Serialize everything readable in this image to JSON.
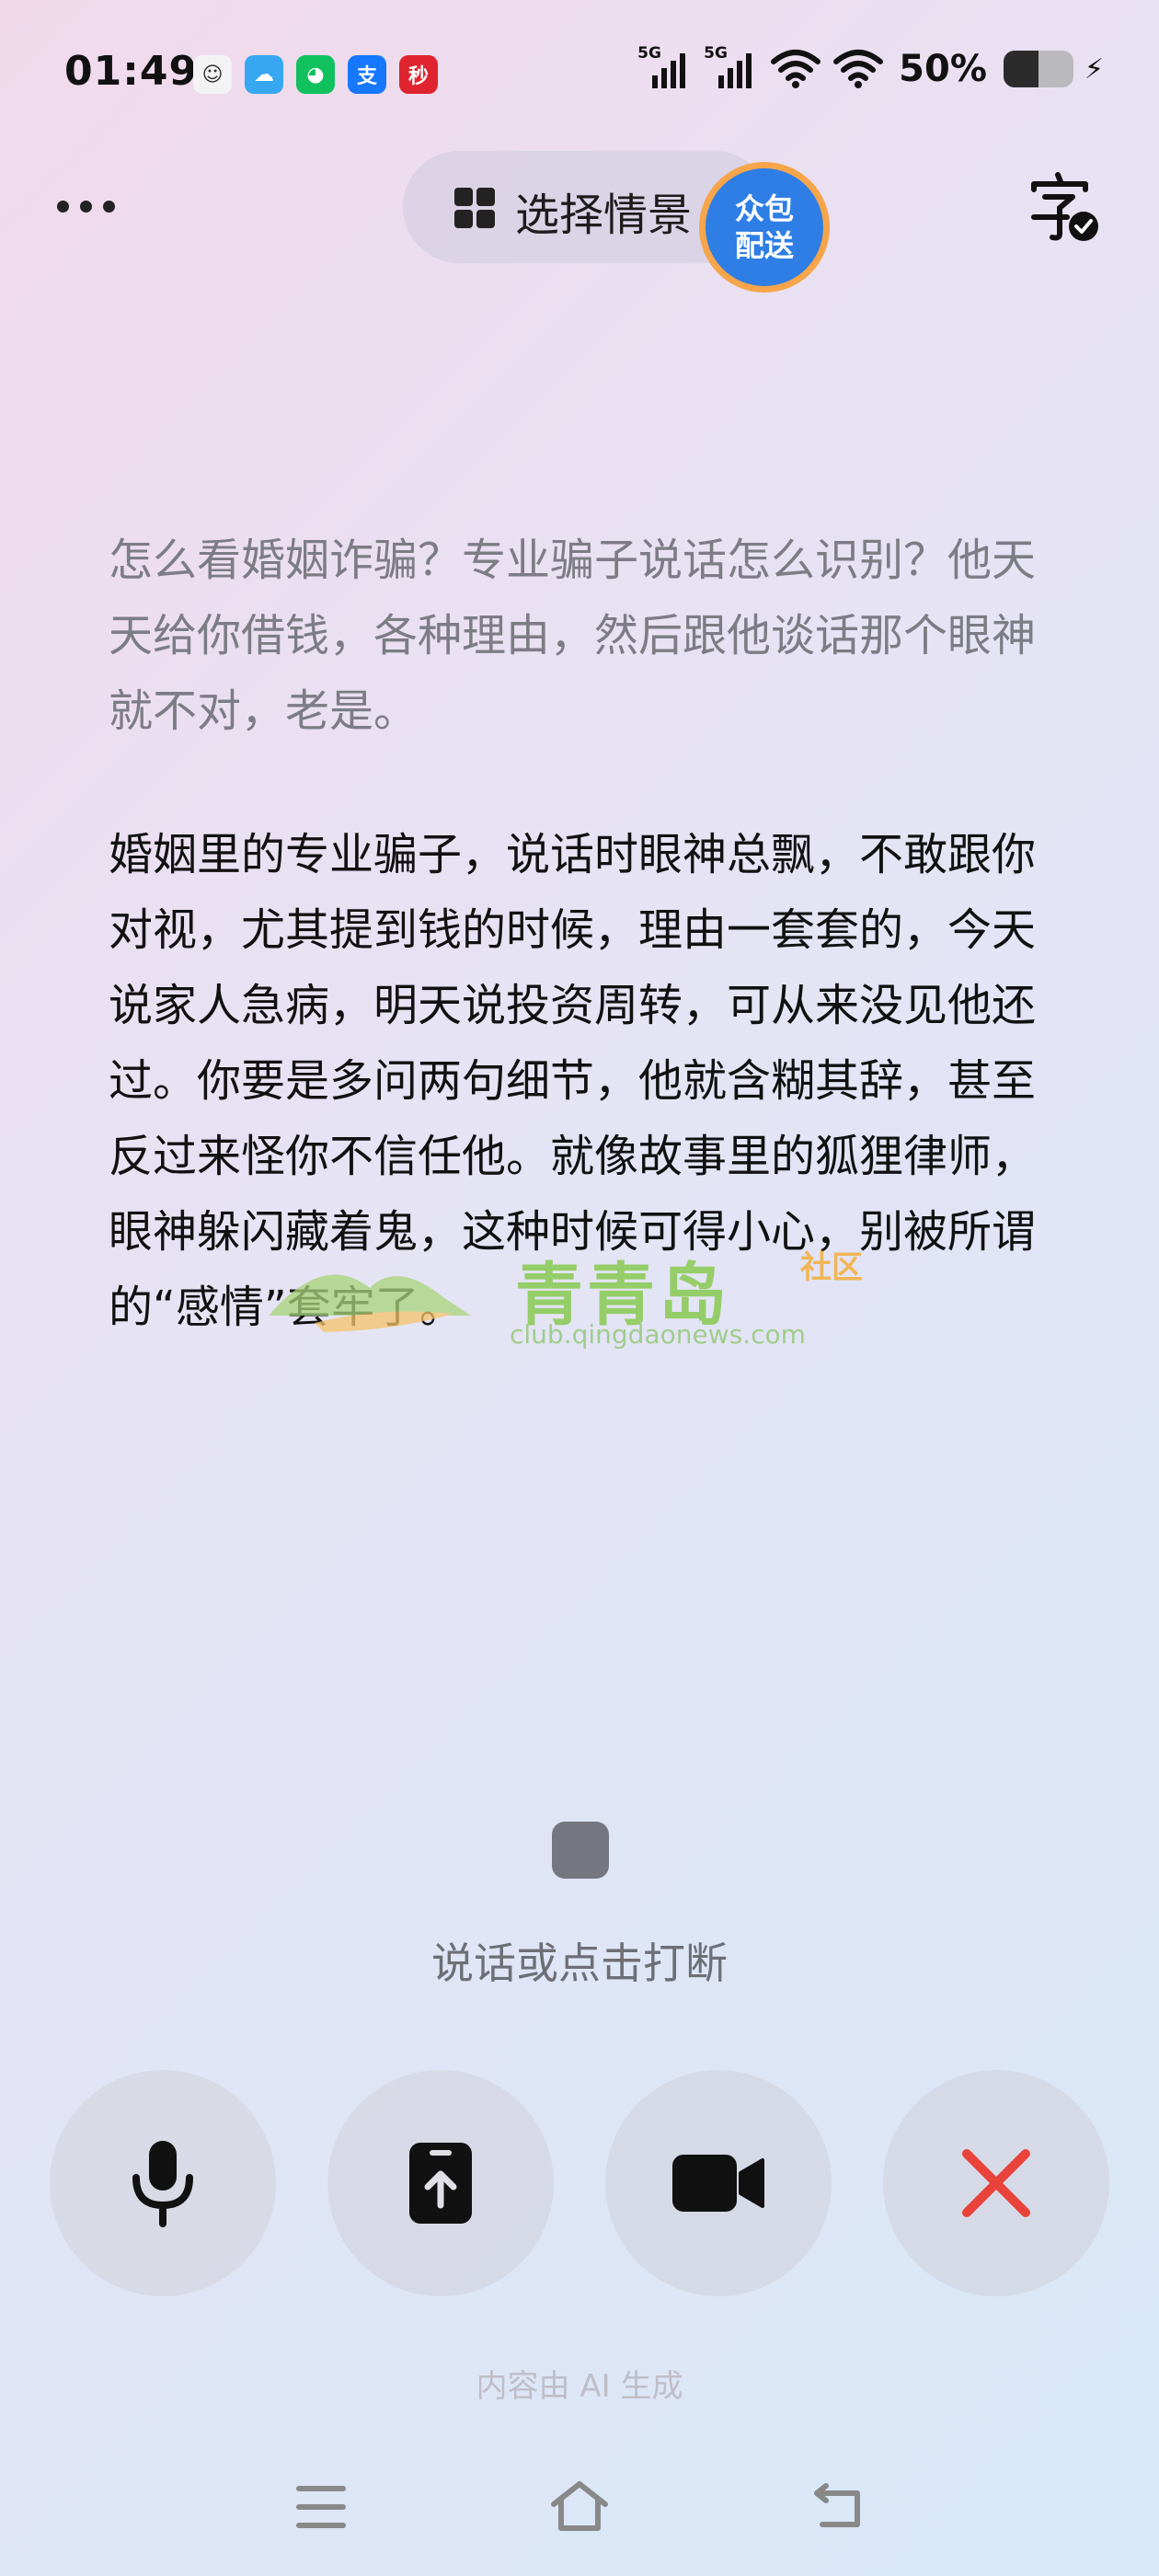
{
  "status_bar": {
    "time": "01:49",
    "network_1": "5G",
    "network_2": "5G",
    "battery_percent": "50%",
    "battery_level": 0.5,
    "app_icons": [
      "avatar-icon",
      "cloud-icon",
      "wechat-icon",
      "alipay-icon",
      "news-app-icon"
    ],
    "alipay_glyph": "支",
    "news_glyph": "秒"
  },
  "header": {
    "scene_label": "选择情景",
    "badge_line1": "众包",
    "badge_line2": "配送"
  },
  "conversation": {
    "question": "怎么看婚姻诈骗？专业骗子说话怎么识别？他天天给你借钱，各种理由，然后跟他谈话那个眼神就不对，老是。",
    "answer": "婚姻里的专业骗子，说话时眼神总飘，不敢跟你对视，尤其提到钱的时候，理由一套套的，今天说家人急病，明天说投资周转，可从来没见他还过。你要是多问两句细节，他就含糊其辞，甚至反过来怪你不信任他。就像故事里的狐狸律师，眼神躲闪藏着鬼，这种时候可得小心，别被所谓的“感情”套牢了。"
  },
  "watermark": {
    "title": "青青岛",
    "sub": "社区",
    "url": "club.qingdaonews.com"
  },
  "voice": {
    "hint": "说话或点击打断"
  },
  "controls": [
    "microphone-icon",
    "upload-icon",
    "video-camera-icon",
    "close-icon"
  ],
  "footer": {
    "ai_note": "内容由 AI 生成"
  },
  "colors": {
    "accent_blue": "#2e7ee6",
    "badge_ring": "#f6a54a",
    "close_red": "#e8423a"
  }
}
